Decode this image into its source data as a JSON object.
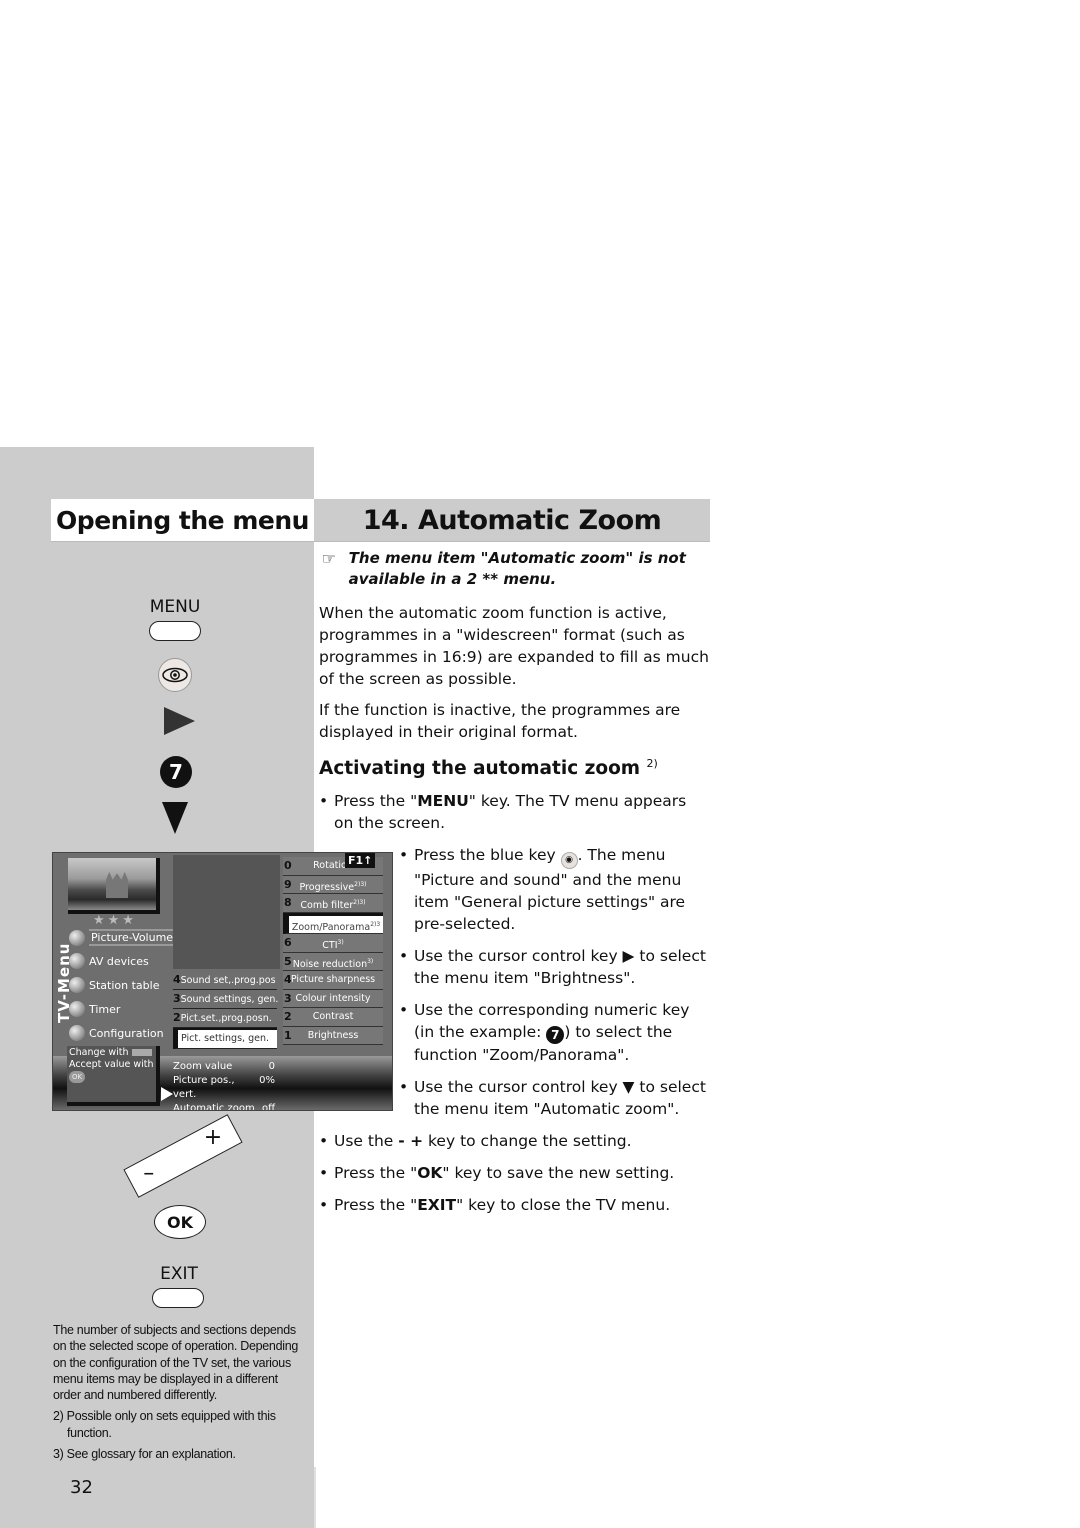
{
  "page": {
    "left_title": "Opening the menu",
    "right_title": "14. Automatic Zoom",
    "page_number": "32"
  },
  "keys": {
    "menu_label": "MENU",
    "seven_label": "7",
    "minus_label": "–",
    "plus_label": "+",
    "ok_label": "OK",
    "exit_label": "EXIT"
  },
  "tv_menu": {
    "vertical_title": "TV-Menu",
    "stars": "★★★",
    "main_items": [
      {
        "label": "Picture-Volume",
        "selected": true
      },
      {
        "label": "AV devices"
      },
      {
        "label": "Station table"
      },
      {
        "label": "Timer"
      },
      {
        "label": "Configuration"
      }
    ],
    "sub_items": [
      {
        "num": "4",
        "label": "Sound set,.prog.pos"
      },
      {
        "num": "3",
        "label": "Sound settings, gen."
      },
      {
        "num": "2",
        "label": "Pict.set.,prog.posn."
      },
      {
        "num": "",
        "label": "Pict. settings, gen.",
        "selected": true
      }
    ],
    "function_items": [
      {
        "num": "0",
        "label": "Rotation"
      },
      {
        "num": "9",
        "label": "Progressive",
        "sup": "2)3)"
      },
      {
        "num": "8",
        "label": "Comb filter",
        "sup": "2)3)"
      },
      {
        "num": "",
        "label": "Zoom/Panorama",
        "sup": "2)3",
        "selected": true
      },
      {
        "num": "6",
        "label": "CTI",
        "sup": "3)"
      },
      {
        "num": "5",
        "label": "Noise reduction",
        "sup": "3)"
      },
      {
        "num": "4",
        "label": "Picture sharpness"
      },
      {
        "num": "3",
        "label": "Colour intensity"
      },
      {
        "num": "2",
        "label": "Contrast"
      },
      {
        "num": "1",
        "label": "Brightness"
      }
    ],
    "f1_label": "F1↑",
    "help": {
      "change_with": "Change with",
      "accept_with": "Accept value with",
      "ok": "OK"
    },
    "values": [
      {
        "label": "Zoom value",
        "value": "0"
      },
      {
        "label": "Picture pos., vert.",
        "value": "0%"
      },
      {
        "label": "Automatic zoom",
        "value": "off"
      }
    ]
  },
  "content": {
    "note_icon": "☞",
    "note": "The menu item \"Automatic zoom\" is not available in a 2 ** menu.",
    "para1": "When the automatic zoom function is active, programmes in a \"widescreen\" format (such as programmes in 16:9) are expanded to fill as much of the screen as possible.",
    "para2": "If the function is inactive, the programmes are displayed in their original format.",
    "heading": "Activating the automatic zoom",
    "heading_sup": "2)",
    "steps": {
      "s1_a": "Press the \"",
      "s1_key": "MENU",
      "s1_b": "\" key. The TV menu appears on the screen.",
      "s2_a": "Press the blue key ",
      "s2_b": ". The menu \"Picture and sound\" and the menu item \"General picture settings\" are pre-selected.",
      "s3": "Use the cursor control key ▶ to select the menu item \"Brightness\".",
      "s4_a": "Use the corresponding numeric key (in the example: ",
      "s4_key": "7",
      "s4_b": ") to select the function \"Zoom/Panorama\".",
      "s5": "Use the cursor control key ▼ to select the menu item \"Automatic zoom\".",
      "s6_a": "Use the ",
      "s6_key": "- +",
      "s6_b": " key to change the setting.",
      "s7_a": "Press the \"",
      "s7_key": "OK",
      "s7_b": "\" key to save the new setting.",
      "s8_a": "Press the \"",
      "s8_key": "EXIT",
      "s8_b": "\" key to close the TV menu."
    },
    "bullet": "•"
  },
  "footnotes": {
    "general": "The number of subjects and sections depends on the selected scope of operation. Depending on the configuration of the TV set, the various menu items may be displayed in a different order and numbered differently.",
    "fn2": "2) Possible only on sets equipped with this function.",
    "fn3": "3) See glossary for an explanation."
  }
}
